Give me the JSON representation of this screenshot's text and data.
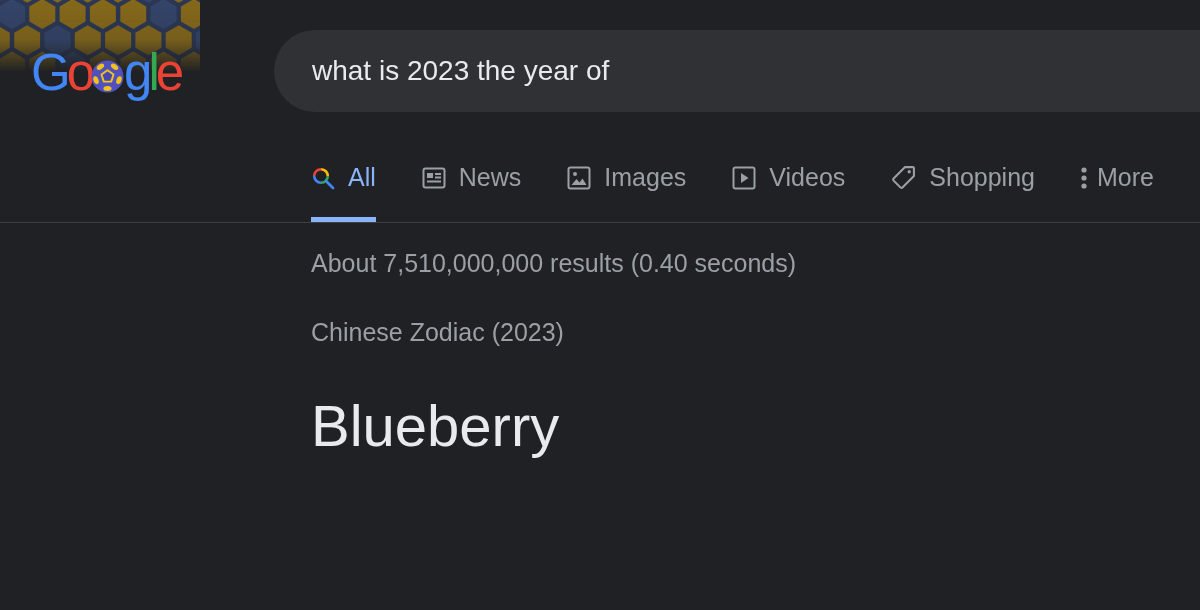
{
  "logo": {
    "letters": [
      {
        "kind": "letter",
        "char": "G",
        "color": "#4285f4"
      },
      {
        "kind": "letter",
        "char": "o",
        "color": "#ea4335"
      },
      {
        "kind": "ball"
      },
      {
        "kind": "letter",
        "char": "g",
        "color": "#4285f4"
      },
      {
        "kind": "letter",
        "char": "l",
        "color": "#34a853"
      },
      {
        "kind": "letter",
        "char": "e",
        "color": "#ea4335"
      }
    ]
  },
  "search": {
    "value": "what is 2023 the year of"
  },
  "tabs": [
    {
      "kind": "search",
      "label": "All",
      "selected": true
    },
    {
      "kind": "news",
      "label": "News",
      "selected": false
    },
    {
      "kind": "image",
      "label": "Images",
      "selected": false
    },
    {
      "kind": "video",
      "label": "Videos",
      "selected": false
    },
    {
      "kind": "tag",
      "label": "Shopping",
      "selected": false
    },
    {
      "kind": "more",
      "label": "More",
      "selected": false
    }
  ],
  "result_stats": "About 7,510,000,000 results (0.40 seconds)",
  "answer": {
    "label": "Chinese Zodiac (2023)",
    "value": "Blueberry"
  }
}
